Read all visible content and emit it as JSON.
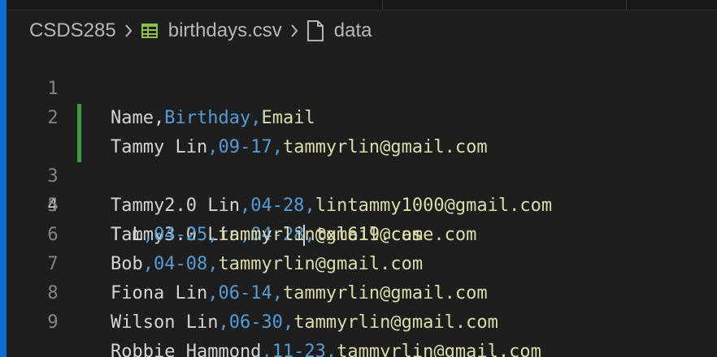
{
  "breadcrumb": {
    "folder": "CSDS285",
    "file": "birthdays.csv",
    "symbol": "data"
  },
  "icons": {
    "file": "csv-table-icon",
    "symbol": "document-icon",
    "separator": "chevron-right-icon"
  },
  "colors": {
    "accent": "#0e6fd3",
    "background": "#1e1e1e",
    "text": "#d4d4d4",
    "date_column": "#569cd6",
    "email_column": "#dcdcaa",
    "line_number": "#858585",
    "modified_marker": "#3f9a3f"
  },
  "editor": {
    "active_line": 4,
    "modified_lines": [
      3,
      4
    ],
    "lines": [
      {
        "number": "1",
        "name": "Name",
        "sep1": ",",
        "birthday": "Birthday",
        "sep2": ",",
        "email": "Email"
      },
      {
        "number": "2",
        "name": "Tammy Lin",
        "sep1": ",",
        "birthday": "09-17",
        "sep2": ",",
        "email": "tammyrlin@gmail.com"
      },
      {
        "number": "3",
        "name": "Tammy2.0 Lin",
        "sep1": ",",
        "birthday": "04-28",
        "sep2": ",",
        "email": "lintammy1000@gmail.com"
      },
      {
        "number": "4",
        "name": "Tammy3.0 Lin",
        "sep1": ",",
        "birthday": "04-28",
        "sep2": ",",
        "email": "txl619@case.com"
      },
      {
        "number": "5",
        "name": "T L",
        "sep1": ",",
        "birthday": "04-25",
        "sep2": ",",
        "email": "tammyrlin@gmail.com"
      },
      {
        "number": "6",
        "name": "Bob",
        "sep1": ",",
        "birthday": "04-08",
        "sep2": ",",
        "email": "tammyrlin@gmail.com"
      },
      {
        "number": "7",
        "name": "Fiona Lin",
        "sep1": ",",
        "birthday": "06-14",
        "sep2": ",",
        "email": "tammyrlin@gmail.com"
      },
      {
        "number": "8",
        "name": "Wilson Lin",
        "sep1": ",",
        "birthday": "06-30",
        "sep2": ",",
        "email": "tammyrlin@gmail.com"
      },
      {
        "number": "9",
        "name": "Robbie Hammond",
        "sep1": ",",
        "birthday": "11-23",
        "sep2": ",",
        "email": "tammyrlin@gmail.com"
      }
    ]
  }
}
